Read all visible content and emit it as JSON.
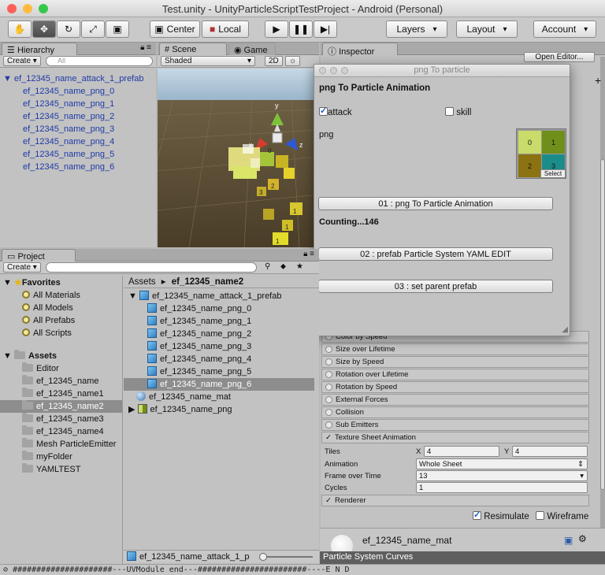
{
  "window": {
    "title": "Test.unity - UnityParticleScriptTestProject - Android (Personal)",
    "traffic_colors": {
      "close": "#fc605c",
      "minimize": "#fdbc40",
      "zoom": "#34c84a"
    }
  },
  "toolbar": {
    "tools": [
      "hand-icon",
      "move-icon",
      "rotate-icon",
      "scale-icon",
      "rect-icon"
    ],
    "pivot": "Center",
    "space": "Local",
    "play": "▶",
    "pause": "❚❚",
    "step": "▶|",
    "layers": "Layers",
    "layout": "Layout",
    "account": "Account"
  },
  "hierarchy": {
    "tab": "Hierarchy",
    "create": "Create",
    "search_placeholder": "All",
    "root": "ef_12345_name_attack_1_prefab",
    "items": [
      "ef_12345_name_png_0",
      "ef_12345_name_png_1",
      "ef_12345_name_png_2",
      "ef_12345_name_png_3",
      "ef_12345_name_png_4",
      "ef_12345_name_png_5",
      "ef_12345_name_png_6"
    ]
  },
  "scene": {
    "tabs": [
      "Scene",
      "Game"
    ],
    "shading": "Shaded",
    "mode_2d": "2D",
    "axis_y": "y",
    "axis_x": "x",
    "axis_z": "z",
    "particle_labels": [
      "0",
      "1",
      "1",
      "1",
      "2",
      "3"
    ]
  },
  "inspector": {
    "tab": "Inspector",
    "open_editor": "Open Editor...",
    "modules": [
      "Color by Speed",
      "Size over Lifetime",
      "Size by Speed",
      "Rotation over Lifetime",
      "Rotation by Speed",
      "External Forces",
      "Collision",
      "Sub Emitters"
    ],
    "texture_sheet": "Texture Sheet Animation",
    "tiles_label": "Tiles",
    "x_label": "X",
    "x_val": "4",
    "y_label": "Y",
    "y_val": "4",
    "animation_label": "Animation",
    "animation_val": "Whole Sheet",
    "frame_label": "Frame over Time",
    "frame_val": "13",
    "cycles_label": "Cycles",
    "cycles_val": "1",
    "renderer": "Renderer",
    "resimulate": "Resimulate",
    "wireframe": "Wireframe",
    "material": "ef_12345_name_mat",
    "curves": "Particle System Curves"
  },
  "popup": {
    "title": "png To particle",
    "heading": "png To Particle Animation",
    "attack": "attack",
    "skill": "skill",
    "png_label": "png",
    "thumb_cells": [
      "0",
      "1",
      "2",
      "3"
    ],
    "select": "Select",
    "btn1": "01 : png To Particle Animation",
    "counting": "Counting...146",
    "btn2": "02 : prefab Particle System YAML EDIT",
    "btn3": "03 : set parent prefab"
  },
  "project": {
    "tab": "Project",
    "create": "Create",
    "favorites": "Favorites",
    "fav_items": [
      "All Materials",
      "All Models",
      "All Prefabs",
      "All Scripts"
    ],
    "assets": "Assets",
    "asset_folders": [
      "Editor",
      "ef_12345_name",
      "ef_12345_name1",
      "ef_12345_name2",
      "ef_12345_name3",
      "ef_12345_name4",
      "Mesh ParticleEmitter",
      "myFolder",
      "YAMLTEST"
    ],
    "breadcrumb_root": "Assets",
    "breadcrumb_sep": "▸",
    "breadcrumb_current": "ef_12345_name2",
    "prefab": "ef_12345_name_attack_1_prefab",
    "children": [
      "ef_12345_name_png_0",
      "ef_12345_name_png_1",
      "ef_12345_name_png_2",
      "ef_12345_name_png_3",
      "ef_12345_name_png_4",
      "ef_12345_name_png_5",
      "ef_12345_name_png_6"
    ],
    "mat": "ef_12345_name_mat",
    "png": "ef_12345_name_png",
    "footer_selected": "ef_12345_name_attack_1_p"
  },
  "status": "#####################---UVModule end---#######################----E N D"
}
